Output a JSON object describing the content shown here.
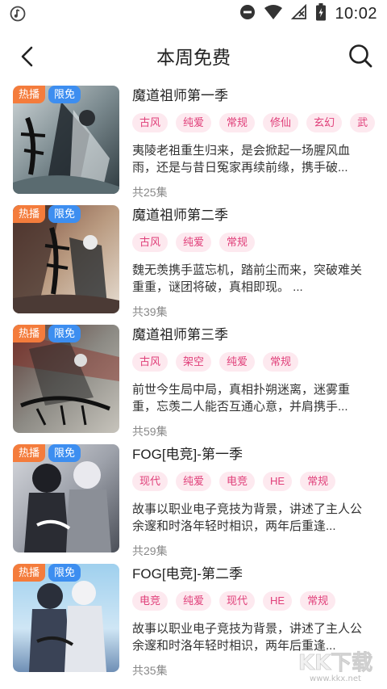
{
  "status_bar": {
    "time": "10:02"
  },
  "header": {
    "title": "本周免费"
  },
  "badges": {
    "hot": "热播",
    "free": "限免"
  },
  "items": [
    {
      "title": "魔道祖师第一季",
      "tags": [
        "古风",
        "纯爱",
        "常规",
        "修仙",
        "玄幻",
        "武"
      ],
      "desc": "夷陵老祖重生归来，是会掀起一场腥风血雨，还是与昔日冤家再续前缘，携手破...",
      "count": "共25集"
    },
    {
      "title": "魔道祖师第二季",
      "tags": [
        "古风",
        "纯爱",
        "常规"
      ],
      "desc": "魏无羡携手蓝忘机，踏前尘而来，突破难关重重，谜团将破，真相即现。 ...",
      "count": "共39集"
    },
    {
      "title": "魔道祖师第三季",
      "tags": [
        "古风",
        "架空",
        "纯爱",
        "常规"
      ],
      "desc": "前世今生局中局，真相扑朔迷离，迷雾重重，忘羡二人能否互通心意，并肩携手...",
      "count": "共59集"
    },
    {
      "title": "FOG[电竞]-第一季",
      "tags": [
        "现代",
        "纯爱",
        "电竞",
        "HE",
        "常规"
      ],
      "desc": "故事以职业电子竞技为背景，讲述了主人公余邃和时洛年轻时相识，两年后重逢...",
      "count": "共29集"
    },
    {
      "title": "FOG[电竞]-第二季",
      "tags": [
        "电竞",
        "纯爱",
        "现代",
        "HE",
        "常规"
      ],
      "desc": "故事以职业电子竞技为背景，讲述了主人公余邃和时洛年轻时相识，两年后重逢...",
      "count": "共35集"
    }
  ],
  "watermark": {
    "text": "KK下载",
    "url": "www.kkx.net"
  }
}
